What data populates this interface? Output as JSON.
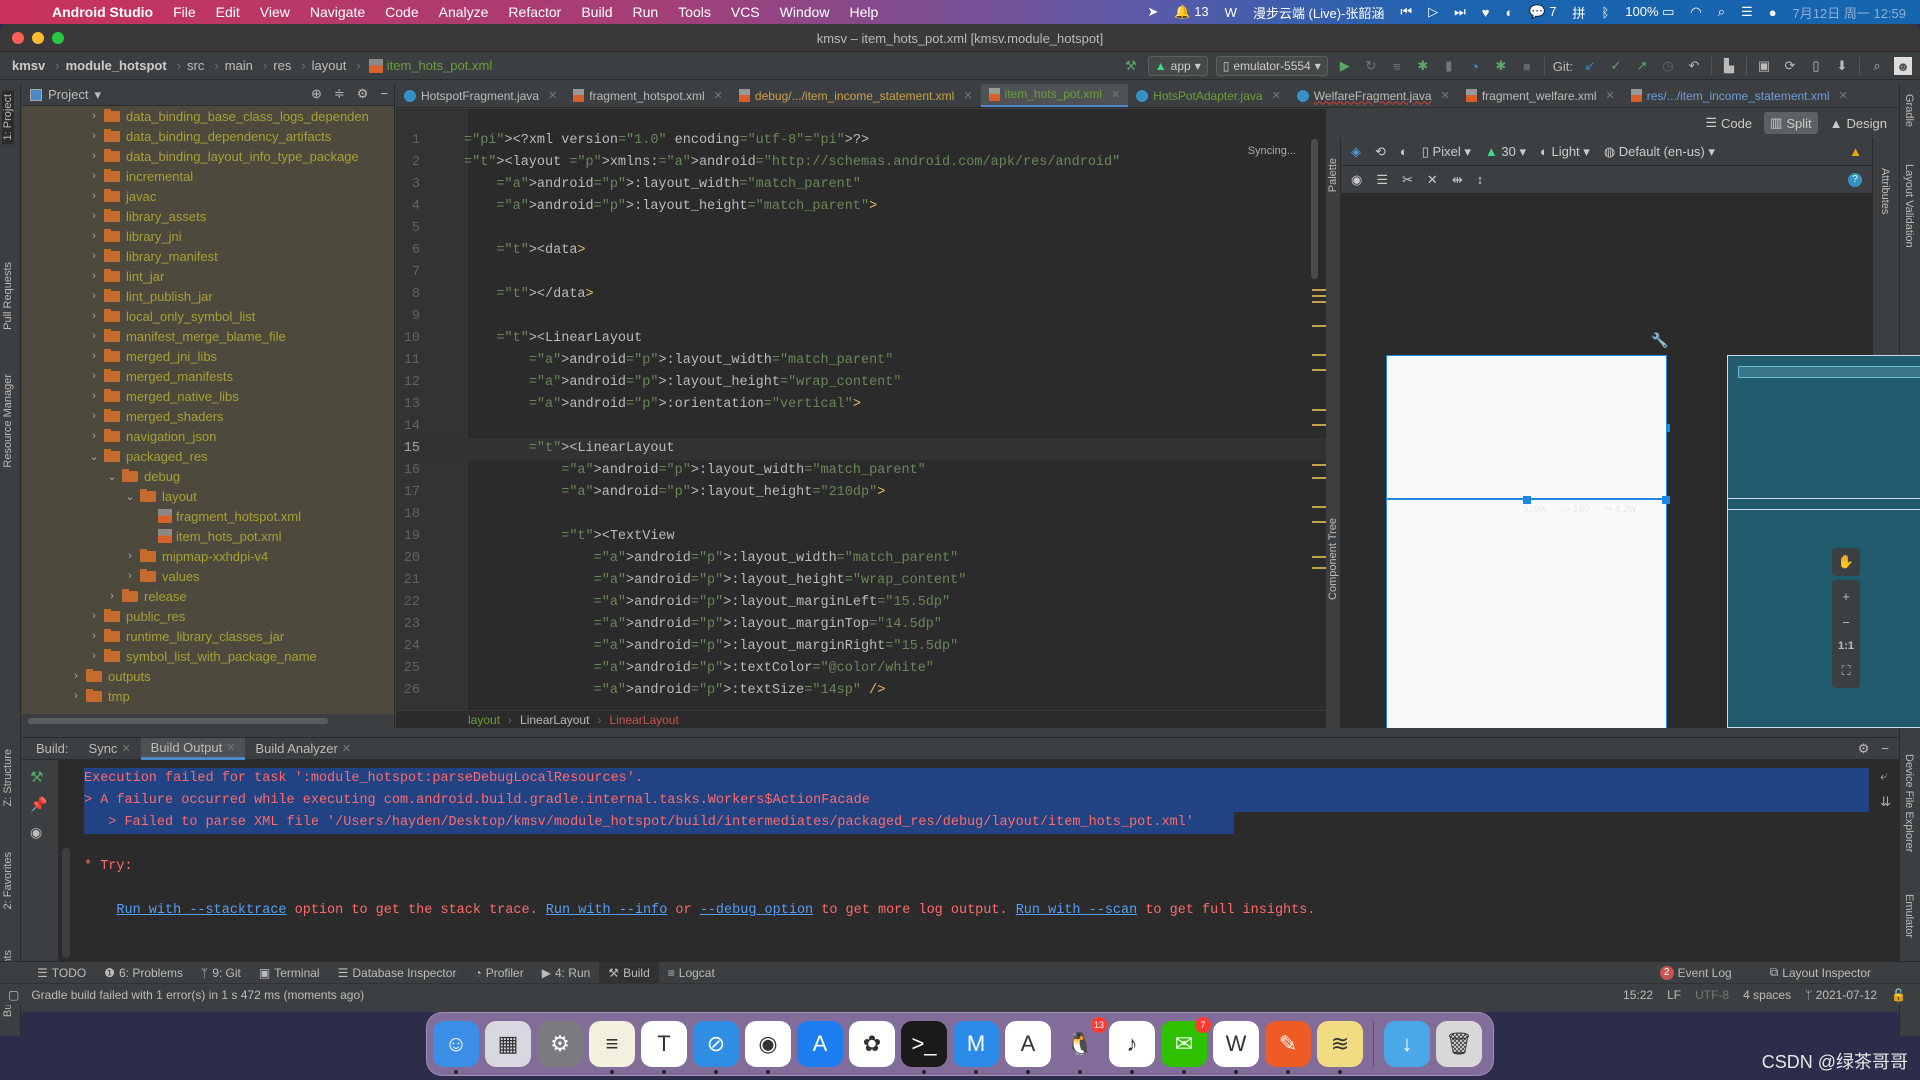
{
  "menubar": {
    "app": "Android Studio",
    "items": [
      "File",
      "Edit",
      "View",
      "Navigate",
      "Code",
      "Analyze",
      "Refactor",
      "Build",
      "Run",
      "Tools",
      "VCS",
      "Window",
      "Help"
    ],
    "qq_count": "13",
    "now_playing": "漫步云端 (Live)-张韶涵",
    "wechat_count": "7",
    "input_method": "拼",
    "battery": "100%",
    "datetime": "7月12日 周一  12:59"
  },
  "window": {
    "title": "kmsv – item_hots_pot.xml [kmsv.module_hotspot]"
  },
  "breadcrumb": [
    "kmsv",
    "module_hotspot",
    "src",
    "main",
    "res",
    "layout",
    "item_hots_pot.xml"
  ],
  "toolbar": {
    "run_config": "app",
    "device": "emulator-5554",
    "git_label": "Git:"
  },
  "project_panel": {
    "title": "Project",
    "tree": [
      {
        "label": "data_binding_base_class_logs_dependen",
        "depth": 1,
        "type": "folder",
        "expanded": false
      },
      {
        "label": "data_binding_dependency_artifacts",
        "depth": 1,
        "type": "folder",
        "expanded": false
      },
      {
        "label": "data_binding_layout_info_type_package",
        "depth": 1,
        "type": "folder",
        "expanded": false
      },
      {
        "label": "incremental",
        "depth": 1,
        "type": "folder",
        "expanded": false
      },
      {
        "label": "javac",
        "depth": 1,
        "type": "folder",
        "expanded": false
      },
      {
        "label": "library_assets",
        "depth": 1,
        "type": "folder",
        "expanded": false
      },
      {
        "label": "library_jni",
        "depth": 1,
        "type": "folder",
        "expanded": false
      },
      {
        "label": "library_manifest",
        "depth": 1,
        "type": "folder",
        "expanded": false
      },
      {
        "label": "lint_jar",
        "depth": 1,
        "type": "folder",
        "expanded": false
      },
      {
        "label": "lint_publish_jar",
        "depth": 1,
        "type": "folder",
        "expanded": false
      },
      {
        "label": "local_only_symbol_list",
        "depth": 1,
        "type": "folder",
        "expanded": false
      },
      {
        "label": "manifest_merge_blame_file",
        "depth": 1,
        "type": "folder",
        "expanded": false
      },
      {
        "label": "merged_jni_libs",
        "depth": 1,
        "type": "folder",
        "expanded": false
      },
      {
        "label": "merged_manifests",
        "depth": 1,
        "type": "folder",
        "expanded": false
      },
      {
        "label": "merged_native_libs",
        "depth": 1,
        "type": "folder",
        "expanded": false
      },
      {
        "label": "merged_shaders",
        "depth": 1,
        "type": "folder",
        "expanded": false
      },
      {
        "label": "navigation_json",
        "depth": 1,
        "type": "folder",
        "expanded": false
      },
      {
        "label": "packaged_res",
        "depth": 1,
        "type": "folder",
        "expanded": true
      },
      {
        "label": "debug",
        "depth": 2,
        "type": "folder",
        "expanded": true
      },
      {
        "label": "layout",
        "depth": 3,
        "type": "folder",
        "expanded": true
      },
      {
        "label": "fragment_hotspot.xml",
        "depth": 4,
        "type": "xml"
      },
      {
        "label": "item_hots_pot.xml",
        "depth": 4,
        "type": "xml"
      },
      {
        "label": "mipmap-xxhdpi-v4",
        "depth": 3,
        "type": "folder",
        "expanded": false
      },
      {
        "label": "values",
        "depth": 3,
        "type": "folder",
        "expanded": false
      },
      {
        "label": "release",
        "depth": 2,
        "type": "folder",
        "expanded": false
      },
      {
        "label": "public_res",
        "depth": 1,
        "type": "folder",
        "expanded": false
      },
      {
        "label": "runtime_library_classes_jar",
        "depth": 1,
        "type": "folder",
        "expanded": false
      },
      {
        "label": "symbol_list_with_package_name",
        "depth": 1,
        "type": "folder",
        "expanded": false
      },
      {
        "label": "outputs",
        "depth": 0,
        "type": "folder",
        "expanded": false
      },
      {
        "label": "tmp",
        "depth": 0,
        "type": "folder",
        "expanded": false
      }
    ]
  },
  "left_tool_windows": [
    "1: Project",
    "Pull Requests",
    "Resource Manager",
    "Z: Structure",
    "2: Favorites",
    "Build Variants"
  ],
  "right_tool_windows": [
    "Gradle",
    "Layout Validation",
    "Device File Explorer",
    "Emulator"
  ],
  "editor_tabs": [
    {
      "label": "HotspotFragment.java",
      "kind": "java",
      "active": false
    },
    {
      "label": "fragment_hotspot.xml",
      "kind": "xml",
      "active": false
    },
    {
      "label": "debug/.../item_income_statement.xml",
      "kind": "xml",
      "active": false
    },
    {
      "label": "item_hots_pot.xml",
      "kind": "xml",
      "active": true
    },
    {
      "label": "HotsPotAdapter.java",
      "kind": "java",
      "active": false
    },
    {
      "label": "WelfareFragment.java",
      "kind": "java",
      "active": false
    },
    {
      "label": "fragment_welfare.xml",
      "kind": "xml",
      "active": false
    },
    {
      "label": "res/.../item_income_statement.xml",
      "kind": "xml",
      "active": false
    }
  ],
  "editor": {
    "status": "Syncing...",
    "current_line": 15,
    "lines": [
      "<?xml version=\"1.0\" encoding=\"utf-8\"?>",
      "<layout xmlns:android=\"http://schemas.android.com/apk/res/android\"",
      "    android:layout_width=\"match_parent\"",
      "    android:layout_height=\"match_parent\">",
      "",
      "    <data>",
      "",
      "    </data>",
      "",
      "    <LinearLayout",
      "        android:layout_width=\"match_parent\"",
      "        android:layout_height=\"wrap_content\"",
      "        android:orientation=\"vertical\">",
      "",
      "        <LinearLayout",
      "            android:layout_width=\"match_parent\"",
      "            android:layout_height=\"210dp\">",
      "",
      "            <TextView",
      "                android:layout_width=\"match_parent\"",
      "                android:layout_height=\"wrap_content\"",
      "                android:layout_marginLeft=\"15.5dp\"",
      "                android:layout_marginTop=\"14.5dp\"",
      "                android:layout_marginRight=\"15.5dp\"",
      "                android:textColor=\"@color/white\"",
      "                android:textSize=\"14sp\" />"
    ],
    "breadcrumb": [
      "layout",
      "LinearLayout",
      "LinearLayout"
    ]
  },
  "design_panel": {
    "modes": [
      "Code",
      "Split",
      "Design"
    ],
    "active_mode": "Split",
    "device": "Pixel",
    "api": "30",
    "theme": "Light",
    "locale": "Default (en-us)",
    "side_labels": [
      "Palette",
      "Component Tree",
      "Attributes"
    ],
    "preview_stats": [
      "510w",
      "160",
      "4.2w"
    ],
    "zoom_controls": [
      "+",
      "−",
      "1:1"
    ]
  },
  "build_panel": {
    "label": "Build:",
    "tabs": [
      {
        "label": "Sync",
        "active": false
      },
      {
        "label": "Build Output",
        "active": true
      },
      {
        "label": "Build Analyzer",
        "active": false
      }
    ],
    "output": [
      {
        "text": "Execution failed for task ':module_hotspot:parseDebugLocalResources'.",
        "selected": true
      },
      {
        "text": "> A failure occurred while executing com.android.build.gradle.internal.tasks.Workers$ActionFacade",
        "selected": true
      },
      {
        "text": "   > Failed to parse XML file '/Users/hayden/Desktop/kmsv/module_hotspot/build/intermediates/packaged_res/debug/layout/item_hots_pot.xml'",
        "selected": true
      },
      {
        "text": "",
        "selected": false
      },
      {
        "text": "* Try:",
        "selected": false
      }
    ],
    "try_line": {
      "link1": "Run with --stacktrace",
      "text1": " option to get the stack trace. ",
      "link2": "Run with --info",
      "text2": " or ",
      "link3": "--debug option",
      "text3": " to get more log output. ",
      "link4": "Run with --scan",
      "text4": " to get full insights."
    }
  },
  "bottom_bar": {
    "items": [
      {
        "label": "TODO",
        "icon": "list-icon"
      },
      {
        "label": "6: Problems",
        "icon": "problems-icon"
      },
      {
        "label": "9: Git",
        "icon": "git-icon"
      },
      {
        "label": "Terminal",
        "icon": "terminal-icon"
      },
      {
        "label": "Database Inspector",
        "icon": "database-icon"
      },
      {
        "label": "Profiler",
        "icon": "profiler-icon"
      },
      {
        "label": "4: Run",
        "icon": "run-icon"
      },
      {
        "label": "Build",
        "icon": "hammer-icon",
        "active": true
      },
      {
        "label": "Logcat",
        "icon": "logcat-icon"
      }
    ],
    "event_log": "Event Log",
    "event_log_count": "2",
    "layout_inspector": "Layout Inspector"
  },
  "status_bar": {
    "message": "Gradle build failed with 1 error(s) in 1 s 472 ms (moments ago)",
    "position": "15:22",
    "line_sep": "LF",
    "encoding": "UTF-8",
    "indent": "4 spaces",
    "branch": "2021-07-12"
  },
  "dock": {
    "apps": [
      {
        "name": "finder",
        "color": "#3a8ee6",
        "glyph": "☺"
      },
      {
        "name": "launchpad",
        "color": "#d8d8e0",
        "glyph": "▦"
      },
      {
        "name": "system-preferences",
        "color": "#7a7a80",
        "glyph": "⚙"
      },
      {
        "name": "notes",
        "color": "#f4f0e0",
        "glyph": "≡"
      },
      {
        "name": "typora",
        "color": "#ffffff",
        "glyph": "T"
      },
      {
        "name": "safari",
        "color": "#2f8de4",
        "glyph": "⊘"
      },
      {
        "name": "chrome",
        "color": "#ffffff",
        "glyph": "◉"
      },
      {
        "name": "app-store",
        "color": "#1c7ef0",
        "glyph": "A"
      },
      {
        "name": "photos",
        "color": "#ffffff",
        "glyph": "✿"
      },
      {
        "name": "terminal",
        "color": "#1a1a1a",
        "glyph": ">_"
      },
      {
        "name": "mindnode",
        "color": "#2a8ae8",
        "glyph": "M"
      },
      {
        "name": "android-studio",
        "color": "#ffffff",
        "glyph": "A"
      },
      {
        "name": "qq",
        "color": "transparent",
        "glyph": "🐧",
        "badge": "13"
      },
      {
        "name": "qq-music",
        "color": "#ffffff",
        "glyph": "♪"
      },
      {
        "name": "wechat",
        "color": "#2dc100",
        "glyph": "✉",
        "badge": "7"
      },
      {
        "name": "wps",
        "color": "#ffffff",
        "glyph": "W"
      },
      {
        "name": "postman",
        "color": "#ef5b25",
        "glyph": "✎"
      },
      {
        "name": "stickies",
        "color": "#f2dc82",
        "glyph": "≋"
      },
      {
        "name": "downloads",
        "color": "#4aa8e8",
        "glyph": "↓"
      },
      {
        "name": "trash",
        "color": "#d8d8d8",
        "glyph": "🗑"
      }
    ]
  },
  "watermark": "CSDN @绿茶哥哥",
  "colors": {
    "error_text": "#ff6b68",
    "link": "#589df6",
    "selection": "#214283",
    "accent": "#4a88c7",
    "preview_teal": "#235b6e"
  }
}
